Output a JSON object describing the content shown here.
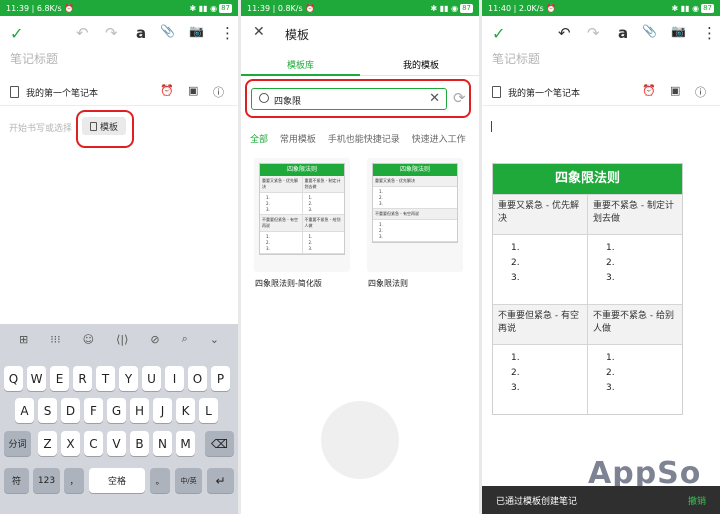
{
  "panel1": {
    "status": {
      "left": "11:39 | 6.8K/s ⏰",
      "right": "✱ ▮▮ ◉",
      "battery": "87"
    },
    "toolbar": {
      "check": "✓",
      "undo": "↶",
      "redo": "↷",
      "format": "a",
      "attach": "📎",
      "camera": "📷",
      "more": "⋮"
    },
    "title_placeholder": "笔记标题",
    "notebook": "我的第一个笔记本",
    "body_placeholder": "开始书写或选择",
    "template_button": "模板",
    "keyboard": {
      "toolbar": [
        "⊞",
        "⁝⁝⁝",
        "☺",
        "⟨|⟩",
        "⊘",
        "⌕",
        "⌄"
      ],
      "row1": [
        "Q",
        "W",
        "E",
        "R",
        "T",
        "Y",
        "U",
        "I",
        "O",
        "P"
      ],
      "row2": [
        "A",
        "S",
        "D",
        "F",
        "G",
        "H",
        "J",
        "K",
        "L"
      ],
      "row3": [
        "Z",
        "X",
        "C",
        "V",
        "B",
        "N",
        "M"
      ],
      "shift": "分词",
      "backspace": "⌫",
      "symbols": "符",
      "numbers": "123",
      "comma": "，",
      "space": "空格",
      "period": "。",
      "lang": "中/英",
      "enter": "↵"
    }
  },
  "panel2": {
    "status": {
      "left": "11:39 | 0.8K/s ⏰",
      "right": "✱ ▮▮ ◉",
      "battery": "87"
    },
    "close": "✕",
    "title": "模板",
    "tabs": [
      "模板库",
      "我的模板"
    ],
    "search_value": "四象限",
    "clear": "✕",
    "refresh": "⟳",
    "chips": [
      "全部",
      "常用模板",
      "手机也能快捷记录",
      "快速进入工作"
    ],
    "cards": [
      {
        "title": "四象限法则",
        "q1": "重要又紧急 - 优先解决",
        "q2": "重要不紧急 - 制定计划去做",
        "q3": "不重要但紧急 - 有空再说",
        "q4": "不重要不紧急 - 给别人做",
        "label": "四象限法则-简化版"
      },
      {
        "title": "四象限法则",
        "q1": "重要又紧急 - 优先解决",
        "q2": "",
        "q3": "不重要但紧急 - 有空再说",
        "q4": "",
        "label": "四象限法则"
      }
    ],
    "list": [
      "1.",
      "2.",
      "3."
    ]
  },
  "panel3": {
    "status": {
      "left": "11:40 | 2.0K/s ⏰",
      "right": "✱ ▮▮ ◉",
      "battery": "87"
    },
    "title_placeholder": "笔记标题",
    "notebook": "我的第一个笔记本",
    "table_title": "四象限法则",
    "q1": "重要又紧急 - 优先解决",
    "q2": "重要不紧急 - 制定计划去做",
    "q3": "不重要但紧急 - 有空再说",
    "q4": "不重要不紧急 - 给别人做",
    "list": [
      "1.",
      "2.",
      "3."
    ],
    "toast": "已通过模板创建笔记",
    "undo": "撤销",
    "watermark": "AppSo"
  }
}
